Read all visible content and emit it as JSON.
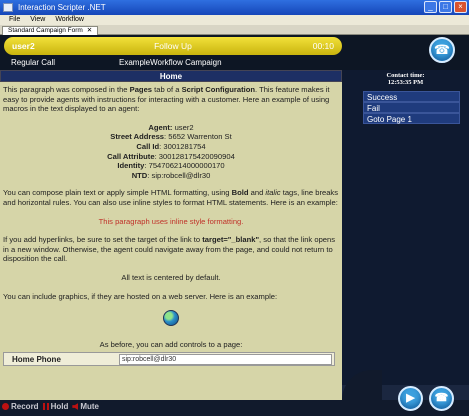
{
  "window": {
    "title": "Interaction Scripter .NET"
  },
  "menu": [
    "File",
    "View",
    "Workflow"
  ],
  "tab": {
    "label": "Standard Campaign Form",
    "close": "✕"
  },
  "header": {
    "user": "user2",
    "disposition_state": "Follow Up",
    "timer": "00:10",
    "call_type": "Regular Call",
    "campaign": "ExampleWorkflow Campaign",
    "status_color": "#e6d21f"
  },
  "home": {
    "title": "Home"
  },
  "content": {
    "intro_pre": "This paragraph was composed in the ",
    "intro_pages": "Pages",
    "intro_mid": " tab of a ",
    "intro_script": "Script Configuration",
    "intro_post": ". This feature makes it easy to provide agents with instructions for interacting with a customer. Here an example of using macros in the text displayed to an agent:",
    "fields": [
      {
        "label": "Agent:",
        "value": "user2"
      },
      {
        "label": "Street Address",
        "value": ": 5652 Warrenton St"
      },
      {
        "label": "Call Id",
        "value": ": 3001281754"
      },
      {
        "label": "Call Attribute",
        "value": ": 300128175420090904"
      },
      {
        "label": "Identity",
        "value": ": 754706214000000170"
      },
      {
        "label": "NTD",
        "value": ": sip:robcell@dlr30"
      }
    ],
    "html_pre": "You can compose plain text or apply simple HTML formatting, using ",
    "html_bold": "Bold",
    "html_and": " and ",
    "html_italic": "italic",
    "html_post": " tags, line breaks and horizontal rules. You can also use inline styles to format HTML statements. Here is an example:",
    "inline_style_text": "This paragraph uses inline style formatting.",
    "link_pre": "If you add hyperlinks, be sure to set the target of the link to ",
    "link_target": "target=\"_blank\"",
    "link_post": ", so that the link opens in a new window. Otherwise, the agent could navigate away from the page, and could not return to disposition the call.",
    "centered_text": "All text is centered by default.",
    "graphics_text": "You can include graphics, if they are hosted on a web server. Here is an example:",
    "controls_text": "As before, you can add controls to a page:",
    "phone_label": "Home Phone",
    "phone_value": "sip:robcell@dlr30"
  },
  "right": {
    "contact_time_label": "Contact time:",
    "contact_time_value": "12:53:35 PM",
    "dispositions": [
      "Success",
      "Fail",
      "Goto Page 1"
    ]
  },
  "bottom": {
    "record": "Record",
    "hold": "Hold",
    "mute": "Mute"
  },
  "icons": {
    "help": "phone-help-icon",
    "next": "next-icon",
    "hangup": "hangup-icon"
  }
}
